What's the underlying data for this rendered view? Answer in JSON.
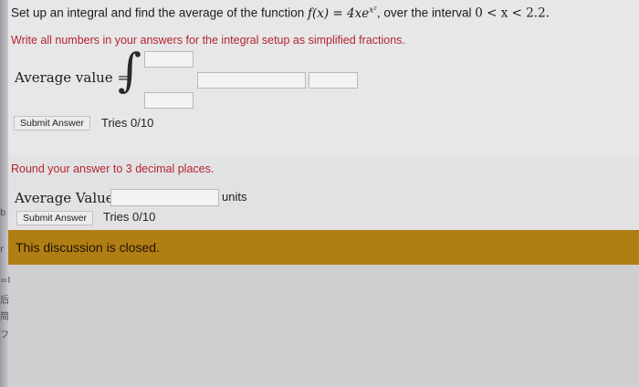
{
  "question1": {
    "prompt_before": "Set up an integral and find the average of the function ",
    "function_expr": "f(x) = 4xe",
    "function_exp": "x²",
    "prompt_after": ", over the interval ",
    "interval": "0 < x < 2.2.",
    "instruction": "Write all numbers in your answers for the integral setup as simplified fractions.",
    "avg_label": "Average value =",
    "integral_symbol": "∫",
    "submit_label": "Submit Answer",
    "tries": "Tries 0/10"
  },
  "question2": {
    "instruction": "Round your answer to 3 decimal places.",
    "avg_label": "Average Value=",
    "units": "units",
    "submit_label": "Submit Answer",
    "tries": "Tries 0/10"
  },
  "discussion": {
    "status": "This discussion is closed."
  },
  "edge_glyphs": [
    "b",
    "r",
    "=I",
    "后",
    "简",
    "フ"
  ],
  "colors": {
    "instruction_red": "#b5252c",
    "closed_bar": "#b17e14"
  }
}
